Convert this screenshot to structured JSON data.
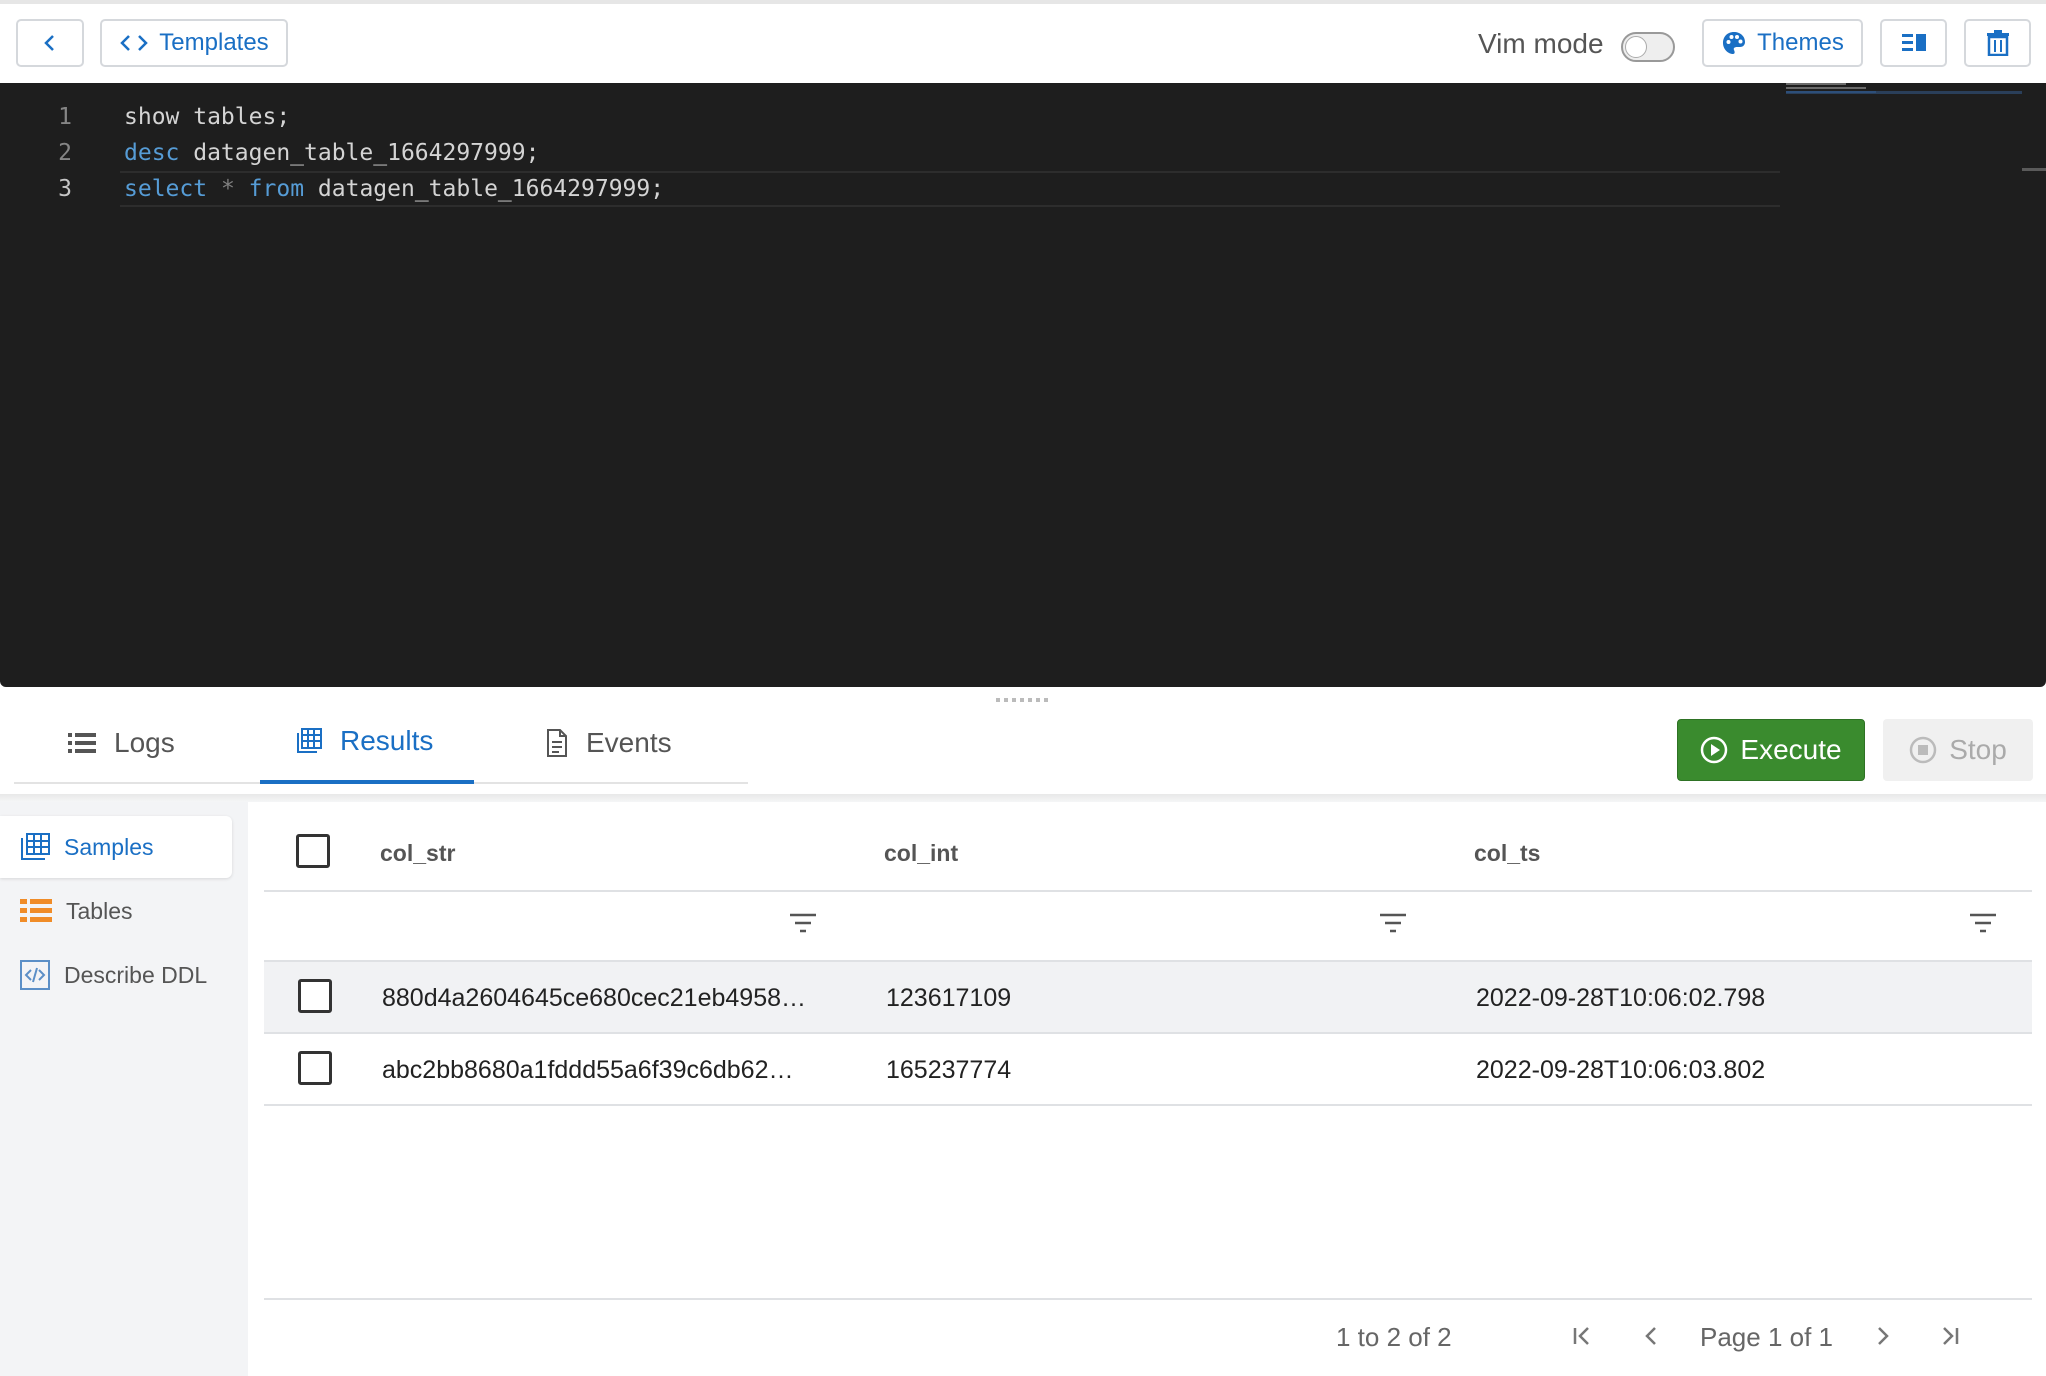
{
  "toolbar": {
    "back_icon": "chevron-left-icon",
    "templates_label": "Templates",
    "vim_label": "Vim mode",
    "vim_enabled": false,
    "themes_label": "Themes"
  },
  "editor": {
    "lines": [
      {
        "num": "1",
        "tokens": [
          {
            "t": "show tables;",
            "k": "plain"
          }
        ]
      },
      {
        "num": "2",
        "tokens": [
          {
            "t": "desc",
            "k": "kw"
          },
          {
            "t": " datagen_table_1664297999;",
            "k": "plain"
          }
        ]
      },
      {
        "num": "3",
        "tokens": [
          {
            "t": "select",
            "k": "kw"
          },
          {
            "t": " ",
            "k": "plain"
          },
          {
            "t": "*",
            "k": "op"
          },
          {
            "t": " ",
            "k": "plain"
          },
          {
            "t": "from",
            "k": "kw"
          },
          {
            "t": " datagen_table_1664297999;",
            "k": "plain"
          }
        ]
      }
    ],
    "current_line": 3
  },
  "tabs": {
    "logs": "Logs",
    "results": "Results",
    "events": "Events",
    "active": "results"
  },
  "actions": {
    "execute": "Execute",
    "stop": "Stop"
  },
  "sidebar": {
    "items": [
      {
        "label": "Samples",
        "icon": "grid-table-icon",
        "active": true
      },
      {
        "label": "Tables",
        "icon": "list-icon",
        "active": false
      },
      {
        "label": "Describe DDL",
        "icon": "code-file-icon",
        "active": false
      }
    ]
  },
  "grid": {
    "columns": [
      "col_str",
      "col_int",
      "col_ts"
    ],
    "rows": [
      [
        "880d4a2604645ce680cec21eb4958…",
        "123617109",
        "2022-09-28T10:06:02.798"
      ],
      [
        "abc2bb8680a1fddd55a6f39c6db62…",
        "165237774",
        "2022-09-28T10:06:03.802"
      ]
    ]
  },
  "pager": {
    "range": "1 to 2 of 2",
    "page": "Page 1 of 1"
  },
  "colors": {
    "accent": "#1a6fc4",
    "execute": "#3a8b2e",
    "editor_bg": "#1e1e1e",
    "keyword": "#569cd6"
  }
}
